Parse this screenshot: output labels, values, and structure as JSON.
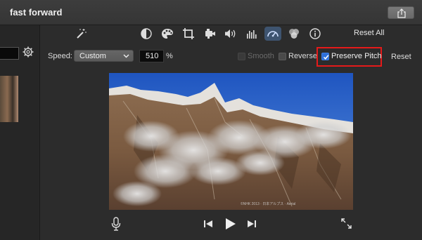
{
  "window": {
    "title": "fast forward"
  },
  "toolbar": {
    "icons": [
      "magic-wand-icon",
      "color-balance-icon",
      "color-palette-icon",
      "crop-icon",
      "stabilization-camera-icon",
      "volume-icon",
      "equalizer-icon",
      "speedometer-icon",
      "overlay-filter-icon",
      "info-icon"
    ],
    "active": "speedometer-icon",
    "reset_all_label": "Reset All"
  },
  "speed": {
    "label": "Speed:",
    "selected": "Custom",
    "percent_value": "510",
    "percent_sign": "%",
    "options": [
      {
        "label": "Smooth",
        "checked": false,
        "enabled": false
      },
      {
        "label": "Reverse",
        "checked": false,
        "enabled": true
      },
      {
        "label": "Preserve Pitch",
        "checked": true,
        "enabled": true
      }
    ],
    "reset_label": "Reset"
  },
  "viewer": {
    "caption": "©NHK 2013 · 日本アルプス · Aerial",
    "controls": [
      "microphone-icon",
      "skip-back-icon",
      "play-icon",
      "skip-forward-icon",
      "fullscreen-icon"
    ]
  },
  "colors": {
    "accent": "#2e6fd9",
    "highlight": "#e51a1a",
    "sky": "#2a62c8"
  }
}
